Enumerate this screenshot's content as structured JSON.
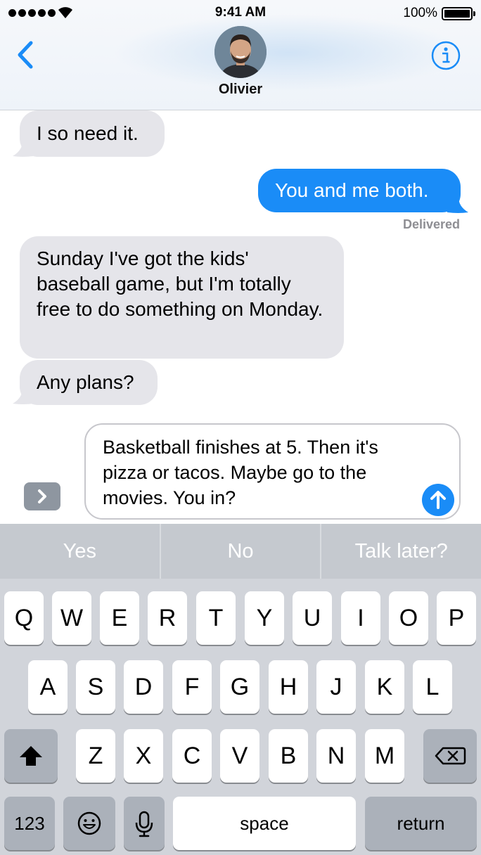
{
  "status_bar": {
    "time": "9:41 AM",
    "battery_percent": "100%",
    "signal_bars": 5
  },
  "header": {
    "contact_name": "Olivier"
  },
  "messages": [
    {
      "direction": "incoming",
      "text": "I so need it."
    },
    {
      "direction": "outgoing",
      "text": "You and me both."
    },
    {
      "direction": "incoming",
      "text": "Sunday I've got the kids' baseball game, but I'm totally free to do something on Monday."
    },
    {
      "direction": "incoming",
      "text": "Any plans?"
    }
  ],
  "delivered_label": "Delivered",
  "compose": {
    "text": "Basketball finishes at 5. Then it's pizza or tacos. Maybe go to the movies. You in?"
  },
  "keyboard": {
    "predictions": [
      "Yes",
      "No",
      "Talk later?"
    ],
    "row1": [
      "Q",
      "W",
      "E",
      "R",
      "T",
      "Y",
      "U",
      "I",
      "O",
      "P"
    ],
    "row2": [
      "A",
      "S",
      "D",
      "F",
      "G",
      "H",
      "J",
      "K",
      "L"
    ],
    "row3": [
      "Z",
      "X",
      "C",
      "V",
      "B",
      "N",
      "M"
    ],
    "numbers_label": "123",
    "space_label": "space",
    "return_label": "return"
  },
  "colors": {
    "accent": "#1a8cf7",
    "incoming_bubble": "#e5e5ea",
    "keyboard_bg": "#d1d4da"
  }
}
